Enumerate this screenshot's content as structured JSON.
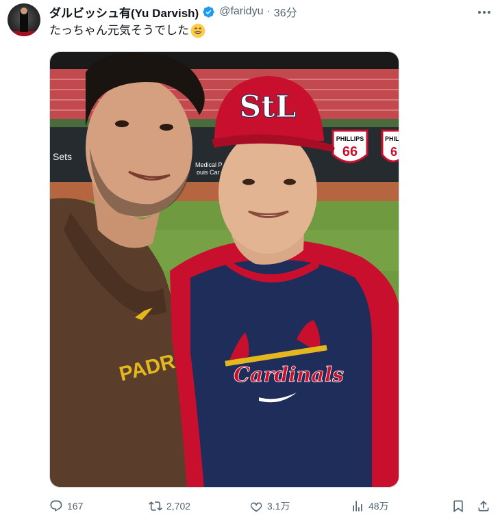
{
  "post": {
    "author": {
      "display_name": "ダルビッシュ有(Yu Darvish)",
      "handle": "@faridyu",
      "verified": true
    },
    "separator": "·",
    "time": "36分",
    "text": "たっちゃん元気そうでした",
    "emoji": "grinning-face-emoji"
  },
  "photo": {
    "signage": {
      "left_fragment": "Sets",
      "board_line1": "Medical P",
      "board_line2": "ouis Car",
      "cap_logo": "StL",
      "jersey_right": "Cardinals",
      "jersey_left": "PADRES",
      "sponsor_word_1": "PHILLIPS",
      "sponsor_number": "66",
      "sponsor_word_2": "PHILL",
      "sponsor_number_2": "6"
    }
  },
  "actions": {
    "replies": "167",
    "reposts": "2,702",
    "likes": "3.1万",
    "views": "48万"
  },
  "colors": {
    "cardinals_red": "#c8102e",
    "padres_brown": "#5a3d2b",
    "padres_gold": "#e3b81f",
    "navy": "#1e2d5a",
    "verified_blue": "#1d9bf0"
  }
}
